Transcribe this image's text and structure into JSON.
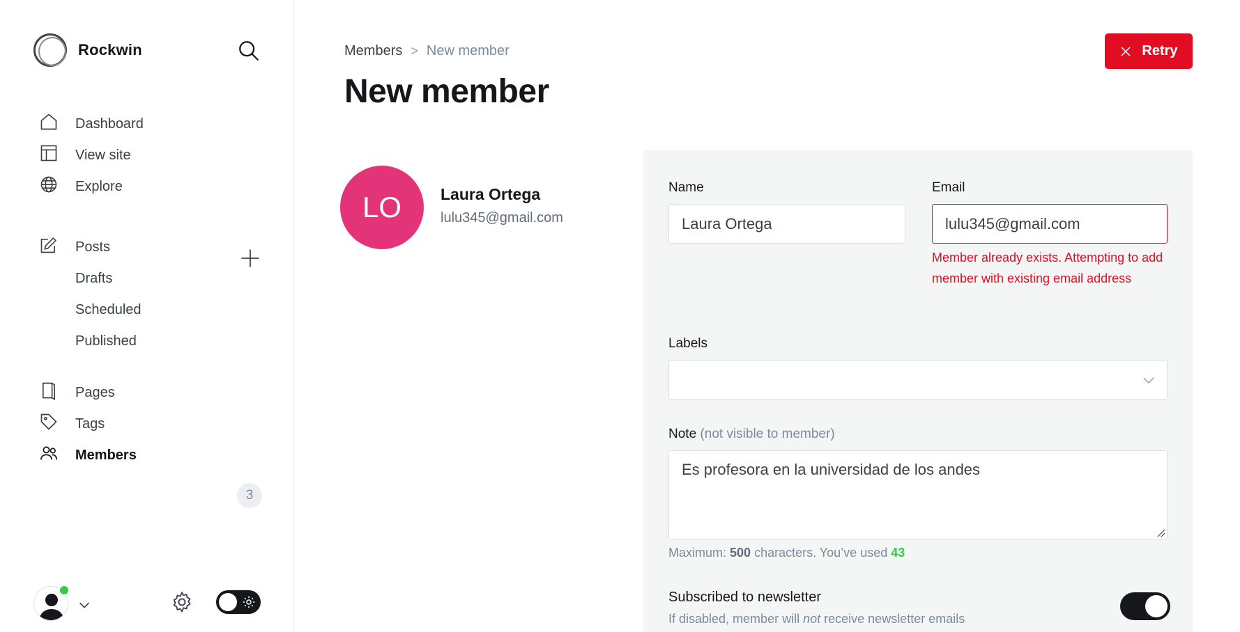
{
  "brand": {
    "name": "Rockwin"
  },
  "nav": {
    "dashboard": "Dashboard",
    "view_site": "View site",
    "explore": "Explore",
    "posts": "Posts",
    "drafts": "Drafts",
    "scheduled": "Scheduled",
    "published": "Published",
    "pages": "Pages",
    "tags": "Tags",
    "members": "Members",
    "members_count": "3"
  },
  "breadcrumb": {
    "parent": "Members",
    "separator": ">",
    "current": "New member"
  },
  "header": {
    "title": "New member",
    "retry_label": "Retry"
  },
  "member": {
    "initials": "LO",
    "name": "Laura Ortega",
    "email": "lulu345@gmail.com",
    "avatar_color": "#e33379"
  },
  "form": {
    "name_label": "Name",
    "name_value": "Laura Ortega",
    "email_label": "Email",
    "email_value": "lulu345@gmail.com",
    "email_error": "Member already exists. Attempting to add member with existing email address",
    "labels_label": "Labels",
    "note_label": "Note",
    "note_sublabel": "(not visible to member)",
    "note_value": "Es profesora en la universidad de los andes",
    "hint_prefix": "Maximum:",
    "hint_max": "500",
    "hint_middle": "characters. You’ve used",
    "hint_used": "43",
    "newsletter_label": "Subscribed to newsletter",
    "newsletter_desc_prefix": "If disabled, member will",
    "newsletter_desc_em": "not",
    "newsletter_desc_suffix": "receive newsletter emails",
    "newsletter_enabled": true
  },
  "colors": {
    "danger": "#e10e23",
    "success": "#30cf43",
    "dark": "#15171a"
  },
  "icons": [
    "search-icon",
    "home-icon",
    "layout-icon",
    "globe-icon",
    "edit-icon",
    "plus-icon",
    "page-icon",
    "tag-icon",
    "members-icon",
    "close-icon",
    "chevron-down-icon",
    "gear-icon",
    "sun-icon",
    "user-icon"
  ]
}
